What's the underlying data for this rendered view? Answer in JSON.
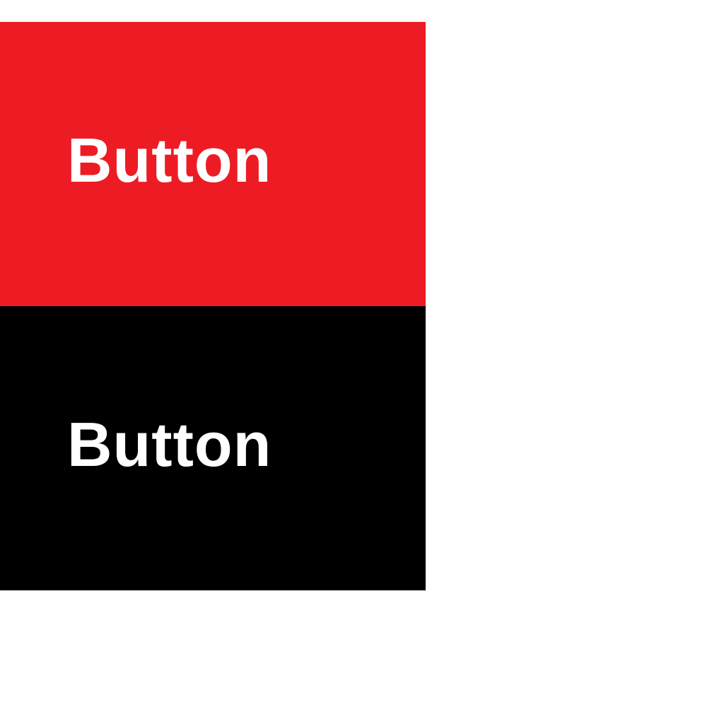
{
  "buttons": [
    {
      "label": "Button",
      "background": "#ed1c24",
      "text_color": "#ffffff"
    },
    {
      "label": "Button",
      "background": "#000000",
      "text_color": "#ffffff"
    }
  ],
  "page": {
    "background": "#ffffff"
  }
}
